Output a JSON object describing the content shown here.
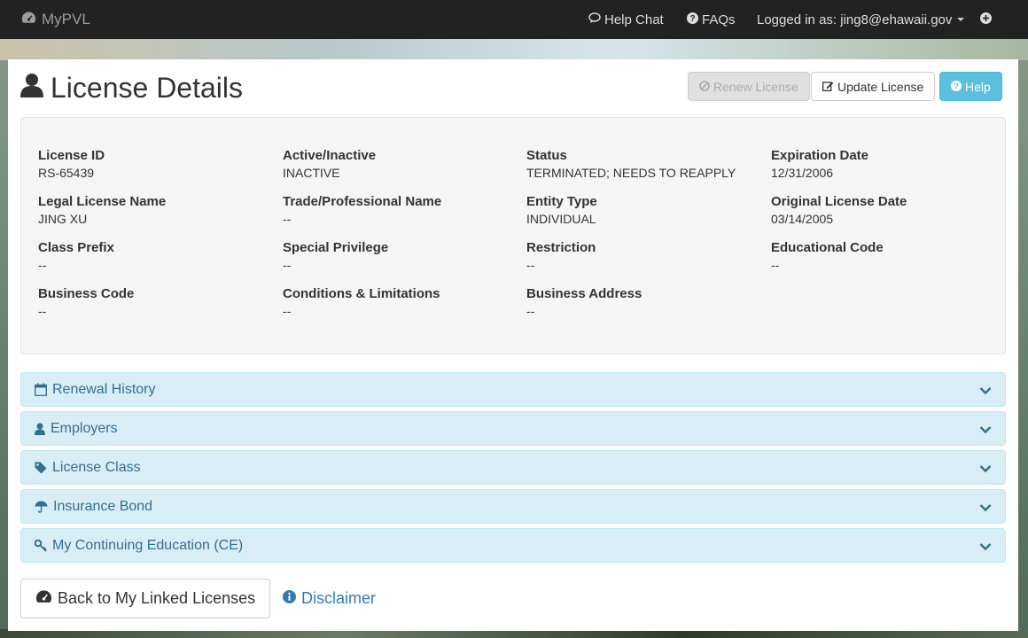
{
  "nav": {
    "brand": "MyPVL",
    "help_chat": "Help Chat",
    "faqs": "FAQs",
    "logged_in": "Logged in as: jing8@ehawaii.gov"
  },
  "header": {
    "title": "License Details",
    "renew_label": "Renew License",
    "update_label": "Update License",
    "help_label": "Help"
  },
  "details": {
    "license_id": {
      "label": "License ID",
      "value": "RS-65439"
    },
    "active": {
      "label": "Active/Inactive",
      "value": "INACTIVE"
    },
    "status": {
      "label": "Status",
      "value": "TERMINATED; NEEDS TO REAPPLY"
    },
    "expiration": {
      "label": "Expiration Date",
      "value": "12/31/2006"
    },
    "legal_name": {
      "label": "Legal License Name",
      "value": "JING XU"
    },
    "trade_name": {
      "label": "Trade/Professional Name",
      "value": "--"
    },
    "entity_type": {
      "label": "Entity Type",
      "value": "INDIVIDUAL"
    },
    "original_date": {
      "label": "Original License Date",
      "value": "03/14/2005"
    },
    "class_prefix": {
      "label": "Class Prefix",
      "value": "--"
    },
    "special_privilege": {
      "label": "Special Privilege",
      "value": "--"
    },
    "restriction": {
      "label": "Restriction",
      "value": "--"
    },
    "educational_code": {
      "label": "Educational Code",
      "value": "--"
    },
    "business_code": {
      "label": "Business Code",
      "value": "--"
    },
    "conditions": {
      "label": "Conditions & Limitations",
      "value": "--"
    },
    "business_address": {
      "label": "Business Address",
      "value": "--"
    }
  },
  "accordion": [
    {
      "label": "Renewal History",
      "icon": "calendar-icon"
    },
    {
      "label": "Employers",
      "icon": "user-icon"
    },
    {
      "label": "License Class",
      "icon": "tag-icon"
    },
    {
      "label": "Insurance Bond",
      "icon": "umbrella-icon"
    },
    {
      "label": "My Continuing Education (CE)",
      "icon": "key-icon"
    }
  ],
  "footer": {
    "back_label": "Back to My Linked Licenses",
    "disclaimer_label": "Disclaimer"
  },
  "colors": {
    "navbar": "#222222",
    "accordion_bg": "#d9edf7",
    "accordion_text": "#31708f",
    "help_button": "#5bc0de",
    "link": "#337ab7"
  }
}
